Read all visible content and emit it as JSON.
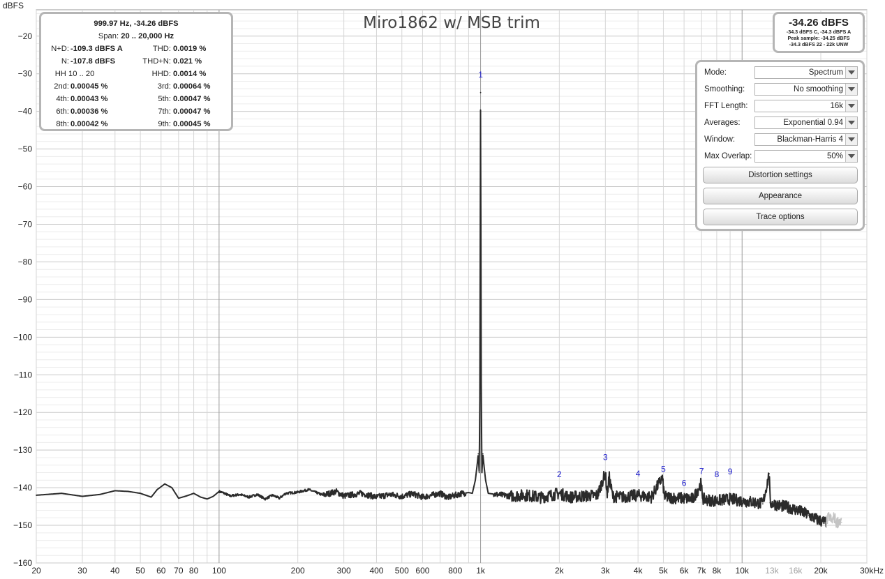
{
  "chart_data": {
    "type": "line",
    "title": "Miro1862 w/ MSB trim",
    "ylabel": "dBFS",
    "xscale": "log",
    "xlim": [
      20,
      30000
    ],
    "ylim": [
      -160,
      -13
    ],
    "grid": true,
    "yticks": [
      -20,
      -30,
      -40,
      -50,
      -60,
      -70,
      -80,
      -90,
      -100,
      -110,
      -120,
      -130,
      -140,
      -150,
      -160
    ],
    "xticks": [
      {
        "v": 20,
        "t": "20"
      },
      {
        "v": 30,
        "t": "30"
      },
      {
        "v": 40,
        "t": "40"
      },
      {
        "v": 50,
        "t": "50"
      },
      {
        "v": 60,
        "t": "60"
      },
      {
        "v": 70,
        "t": "70"
      },
      {
        "v": 80,
        "t": "80"
      },
      {
        "v": 100,
        "t": "100"
      },
      {
        "v": 200,
        "t": "200"
      },
      {
        "v": 300,
        "t": "300"
      },
      {
        "v": 400,
        "t": "400"
      },
      {
        "v": 500,
        "t": "500"
      },
      {
        "v": 600,
        "t": "600"
      },
      {
        "v": 800,
        "t": "800"
      },
      {
        "v": 1000,
        "t": "1k"
      },
      {
        "v": 2000,
        "t": "2k"
      },
      {
        "v": 3000,
        "t": "3k"
      },
      {
        "v": 4000,
        "t": "4k"
      },
      {
        "v": 5000,
        "t": "5k"
      },
      {
        "v": 6000,
        "t": "6k"
      },
      {
        "v": 7000,
        "t": "7k"
      },
      {
        "v": 8000,
        "t": "8k"
      },
      {
        "v": 10000,
        "t": "10k"
      },
      {
        "v": 13000,
        "t": "13k",
        "muted": true
      },
      {
        "v": 16000,
        "t": "16k",
        "muted": true
      },
      {
        "v": 20000,
        "t": "20k"
      },
      {
        "v": 30000,
        "t": "30kHz"
      }
    ],
    "series": [
      {
        "color": "#2b2b2b",
        "points": [
          [
            20,
            -142
          ],
          [
            25,
            -141.5
          ],
          [
            30,
            -142.3
          ],
          [
            35,
            -141.8
          ],
          [
            40,
            -140.8
          ],
          [
            45,
            -141
          ],
          [
            50,
            -141.5
          ],
          [
            55,
            -142.5
          ],
          [
            58,
            -140.5
          ],
          [
            62,
            -139
          ],
          [
            66,
            -140
          ],
          [
            70,
            -142.8
          ],
          [
            75,
            -142.2
          ],
          [
            80,
            -141.5
          ],
          [
            85,
            -142.5
          ],
          [
            90,
            -143
          ],
          [
            95,
            -142.3
          ],
          [
            100,
            -141
          ],
          [
            105,
            -141.5
          ],
          [
            110,
            -142.2
          ],
          [
            120,
            -141.8
          ],
          [
            130,
            -142.5
          ],
          [
            140,
            -141.8
          ],
          [
            150,
            -143
          ],
          [
            160,
            -142
          ],
          [
            170,
            -142.8
          ],
          [
            180,
            -141.5
          ],
          [
            200,
            -141.2
          ],
          [
            220,
            -140.5
          ],
          [
            250,
            -142
          ],
          [
            280,
            -141
          ],
          [
            300,
            -142.2
          ],
          [
            350,
            -141.5
          ],
          [
            400,
            -142.5
          ],
          [
            450,
            -141.8
          ],
          [
            500,
            -142.3
          ],
          [
            550,
            -141.6
          ],
          [
            600,
            -142.5
          ],
          [
            650,
            -142
          ],
          [
            700,
            -141.5
          ],
          [
            750,
            -142.6
          ],
          [
            800,
            -142
          ],
          [
            850,
            -141.5
          ],
          [
            900,
            -141.3
          ],
          [
            930,
            -141.5
          ],
          [
            955,
            -138
          ],
          [
            970,
            -134
          ],
          [
            980,
            -131
          ],
          [
            988,
            -136
          ],
          [
            994,
            -115
          ],
          [
            998,
            -60
          ],
          [
            1000,
            -35
          ],
          [
            1002,
            -60
          ],
          [
            1006,
            -115
          ],
          [
            1012,
            -136
          ],
          [
            1020,
            -131
          ],
          [
            1030,
            -134
          ],
          [
            1045,
            -138
          ],
          [
            1070,
            -141.5
          ],
          [
            1150,
            -141.8
          ],
          [
            1300,
            -142.2
          ],
          [
            1500,
            -142
          ],
          [
            1700,
            -142.6
          ],
          [
            2000,
            -141.5
          ],
          [
            2200,
            -142.5
          ],
          [
            2500,
            -142.2
          ],
          [
            2800,
            -142
          ],
          [
            3000,
            -136
          ],
          [
            3050,
            -142
          ],
          [
            3100,
            -137
          ],
          [
            3200,
            -142.3
          ],
          [
            3500,
            -142.5
          ],
          [
            4000,
            -142
          ],
          [
            4500,
            -142.5
          ],
          [
            4950,
            -137.3
          ],
          [
            5050,
            -142.5
          ],
          [
            5500,
            -142.7
          ],
          [
            6000,
            -142.8
          ],
          [
            6500,
            -143
          ],
          [
            6950,
            -139
          ],
          [
            7100,
            -143
          ],
          [
            7500,
            -143.3
          ],
          [
            8000,
            -143.5
          ],
          [
            8500,
            -143.2
          ],
          [
            9000,
            -143
          ],
          [
            10000,
            -143.5
          ],
          [
            11000,
            -143.8
          ],
          [
            12000,
            -144.3
          ],
          [
            12700,
            -136.3
          ],
          [
            12800,
            -144
          ],
          [
            14000,
            -144.8
          ],
          [
            15000,
            -145.2
          ],
          [
            16000,
            -145.8
          ],
          [
            17000,
            -146.5
          ],
          [
            18000,
            -147.3
          ],
          [
            19000,
            -148.2
          ],
          [
            20000,
            -148.8
          ],
          [
            21000,
            -149.3
          ]
        ]
      },
      {
        "color": "#c4c4c4",
        "points": [
          [
            21000,
            -149.3
          ],
          [
            21500,
            -147.5
          ],
          [
            22000,
            -149
          ],
          [
            22500,
            -147.8
          ],
          [
            23000,
            -149.5
          ],
          [
            23500,
            -148.5
          ],
          [
            24000,
            -149.2
          ]
        ]
      }
    ],
    "annotations": [
      {
        "label": "1",
        "x": 1000,
        "y": -31
      },
      {
        "label": "2",
        "x": 2000,
        "y": -137.2
      },
      {
        "label": "3",
        "x": 3000,
        "y": -132.7
      },
      {
        "label": "4",
        "x": 4000,
        "y": -137
      },
      {
        "label": "5",
        "x": 5000,
        "y": -135.8
      },
      {
        "label": "6",
        "x": 6000,
        "y": -139.5
      },
      {
        "label": "7",
        "x": 7000,
        "y": -136.4
      },
      {
        "label": "8",
        "x": 8000,
        "y": -137.2
      },
      {
        "label": "9",
        "x": 9000,
        "y": -136.5
      }
    ]
  },
  "stats": {
    "line1": "999.97 Hz, -34.26 dBFS",
    "span_label": "Span:",
    "span_value": "20 .. 20,000 Hz",
    "rows": [
      {
        "l1": "N+D:",
        "v1": "-109.3 dBFS A",
        "l2": "THD:",
        "v2": "0.0019 %"
      },
      {
        "l1": "N:",
        "v1": "-107.8 dBFS",
        "l2": "THD+N:",
        "v2": "0.021 %"
      },
      {
        "l1": "HH 10 .. 20",
        "v1": "",
        "l2": "HHD:",
        "v2": "0.0014 %"
      },
      {
        "l1": "2nd:",
        "v1": "0.00045 %",
        "l2": "3rd:",
        "v2": "0.00064 %"
      },
      {
        "l1": "4th:",
        "v1": "0.00043 %",
        "l2": "5th:",
        "v2": "0.00047 %"
      },
      {
        "l1": "6th:",
        "v1": "0.00036 %",
        "l2": "7th:",
        "v2": "0.00047 %"
      },
      {
        "l1": "8th:",
        "v1": "0.00042 %",
        "l2": "9th:",
        "v2": "0.00045 %"
      }
    ]
  },
  "level": {
    "main": "-34.26 dBFS",
    "sub1": "-34.3 dBFS C, -34.3 dBFS A",
    "sub2": "Peak sample: -34.25 dBFS",
    "sub3": "-34.3 dBFS 22 - 22k UNW"
  },
  "controls": {
    "mode_label": "Mode:",
    "mode_value": "Spectrum",
    "smoothing_label": "Smoothing:",
    "smoothing_value": "No  smoothing",
    "fft_label": "FFT Length:",
    "fft_value": "16k",
    "averages_label": "Averages:",
    "averages_value": "Exponential 0.94",
    "window_label": "Window:",
    "window_value": "Blackman-Harris 4",
    "overlap_label": "Max Overlap:",
    "overlap_value": "50%",
    "distortion_button": "Distortion settings",
    "appearance_button": "Appearance",
    "trace_button": "Trace options"
  }
}
